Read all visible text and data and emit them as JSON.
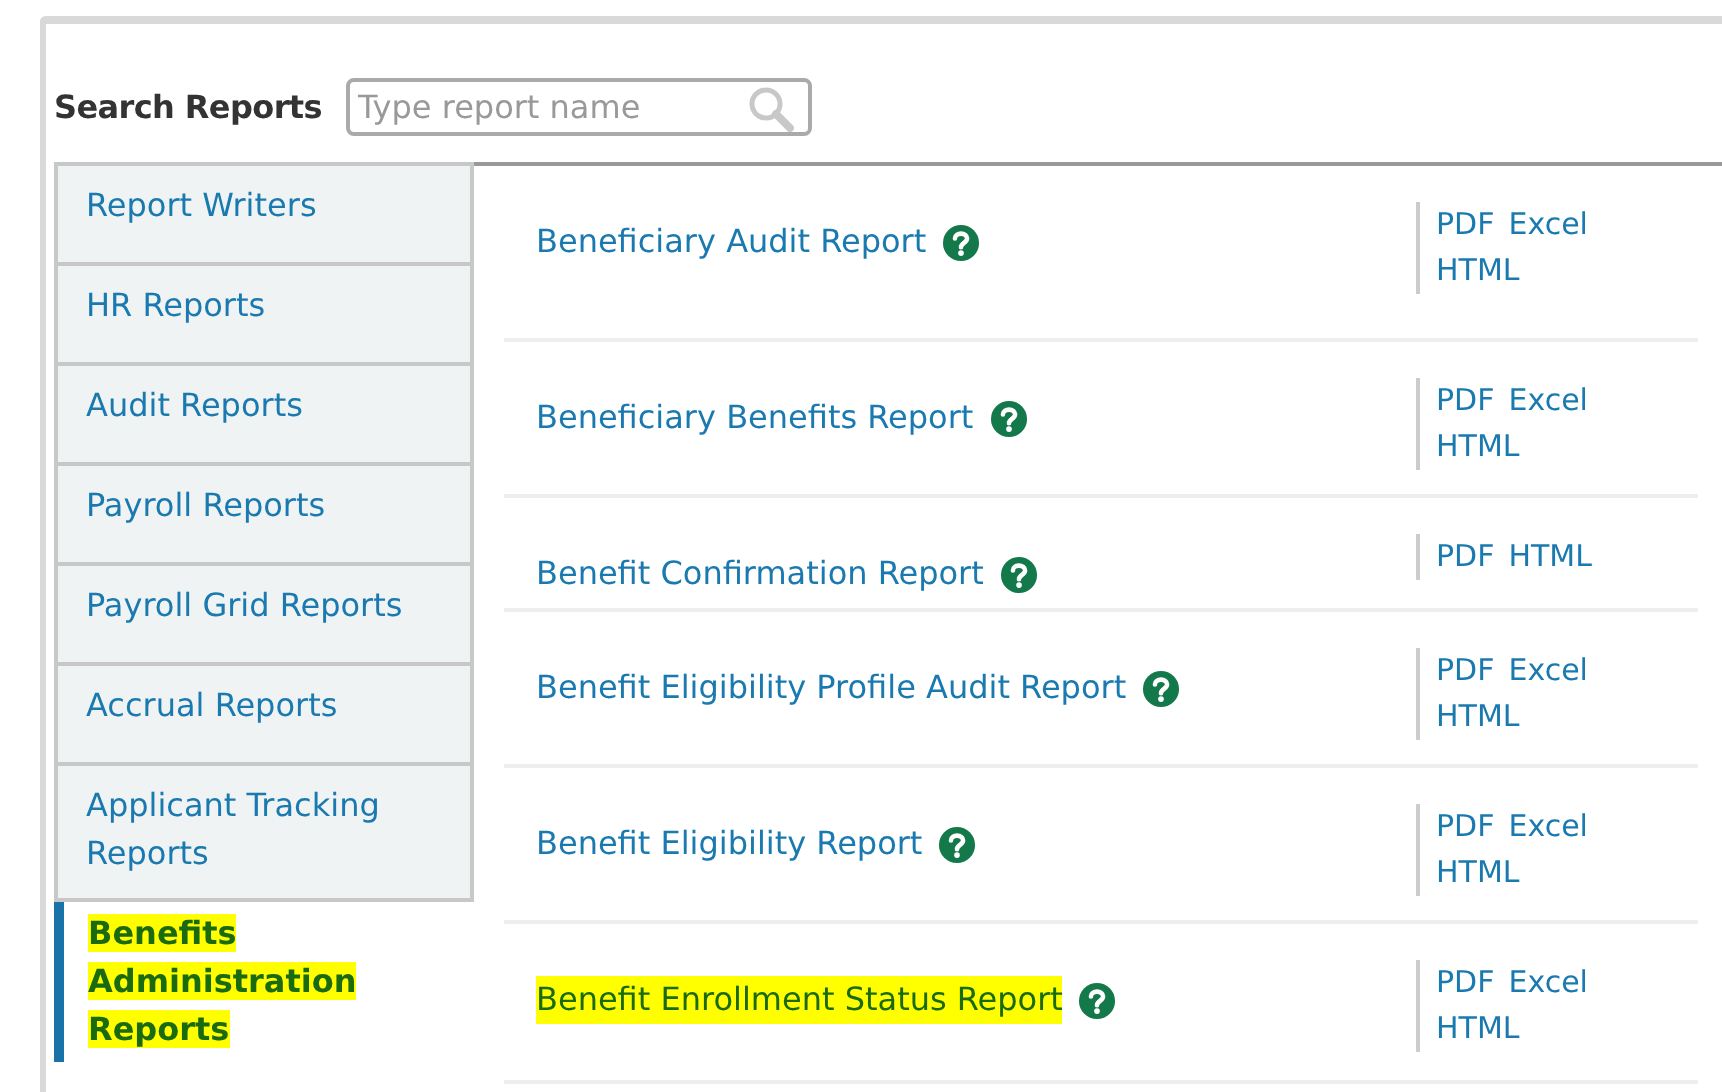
{
  "search": {
    "label": "Search Reports",
    "placeholder": "Type report name"
  },
  "categories": [
    {
      "label": "Report Writers",
      "selected": false,
      "highlighted": false
    },
    {
      "label": "HR Reports",
      "selected": false,
      "highlighted": false
    },
    {
      "label": "Audit Reports",
      "selected": false,
      "highlighted": false
    },
    {
      "label": "Payroll Reports",
      "selected": false,
      "highlighted": false
    },
    {
      "label": "Payroll Grid Reports",
      "selected": false,
      "highlighted": false
    },
    {
      "label": "Accrual Reports",
      "selected": false,
      "highlighted": false
    },
    {
      "label": "Applicant Tracking Reports",
      "selected": false,
      "highlighted": false
    },
    {
      "label": "Benefits Administration Reports",
      "selected": true,
      "highlighted": true
    }
  ],
  "reports": [
    {
      "title": "Beneficiary Audit Report",
      "highlighted": false,
      "formats": [
        "PDF",
        "Excel",
        "HTML"
      ]
    },
    {
      "title": "Beneficiary Benefits Report",
      "highlighted": false,
      "formats": [
        "PDF",
        "Excel",
        "HTML"
      ]
    },
    {
      "title": "Benefit Confirmation Report",
      "highlighted": false,
      "formats": [
        "PDF",
        "HTML"
      ]
    },
    {
      "title": "Benefit Eligibility Profile Audit Report",
      "highlighted": false,
      "formats": [
        "PDF",
        "Excel",
        "HTML"
      ]
    },
    {
      "title": "Benefit Eligibility Report",
      "highlighted": false,
      "formats": [
        "PDF",
        "Excel",
        "HTML"
      ]
    },
    {
      "title": "Benefit Enrollment Status Report",
      "highlighted": true,
      "formats": [
        "PDF",
        "Excel",
        "HTML"
      ]
    }
  ]
}
